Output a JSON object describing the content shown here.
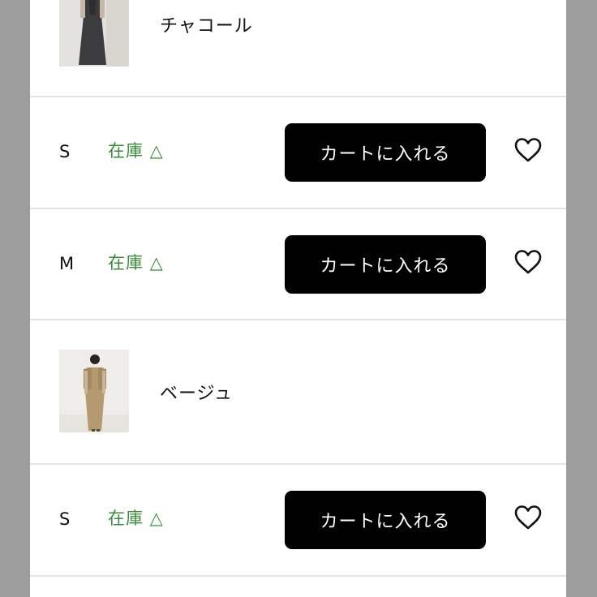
{
  "variants": [
    {
      "color_name": "チャコール",
      "sizes": [
        {
          "size": "S",
          "stock": "在庫 △",
          "cart_label": "カートに入れる"
        },
        {
          "size": "M",
          "stock": "在庫 △",
          "cart_label": "カートに入れる"
        }
      ]
    },
    {
      "color_name": "ベージュ",
      "sizes": [
        {
          "size": "S",
          "stock": "在庫 △",
          "cart_label": "カートに入れる"
        }
      ]
    }
  ],
  "colors": {
    "stock_green": "#3a8c3a",
    "button_black": "#000000",
    "side_gray": "#9e9e9e"
  },
  "icons": {
    "favorite": "heart-outline-icon"
  }
}
